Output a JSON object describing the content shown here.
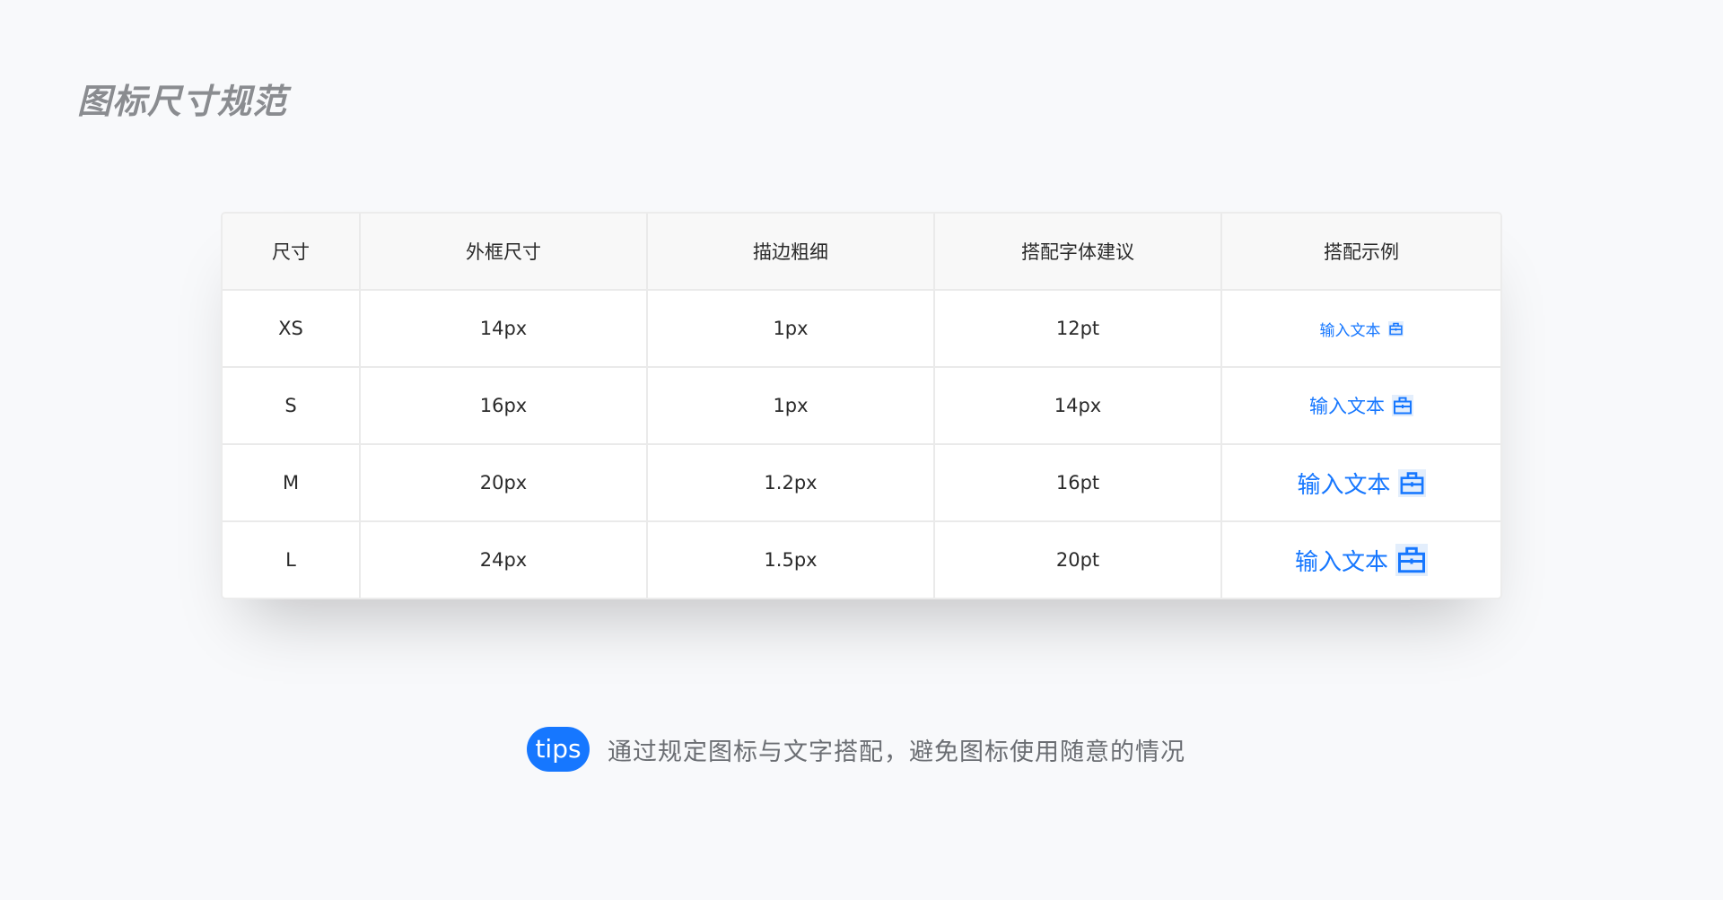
{
  "title": "图标尺寸规范",
  "table": {
    "headers": [
      "尺寸",
      "外框尺寸",
      "描边粗细",
      "搭配字体建议",
      "搭配示例"
    ],
    "rows": [
      {
        "size": "XS",
        "frame": "14px",
        "stroke": "1px",
        "font": "12pt",
        "sample": "输入文本"
      },
      {
        "size": "S",
        "frame": "16px",
        "stroke": "1px",
        "font": "14px",
        "sample": "输入文本"
      },
      {
        "size": "M",
        "frame": "20px",
        "stroke": "1.2px",
        "font": "16pt",
        "sample": "输入文本"
      },
      {
        "size": "L",
        "frame": "24px",
        "stroke": "1.5px",
        "font": "20pt",
        "sample": "输入文本"
      }
    ]
  },
  "sample_icon": "briefcase-icon",
  "tips": {
    "badge": "tips",
    "text": "通过规定图标与文字搭配，避免图标使用随意的情况"
  },
  "colors": {
    "accent": "#1677ff",
    "icon_background": "#e3eefc",
    "title": "#8a8c90"
  }
}
